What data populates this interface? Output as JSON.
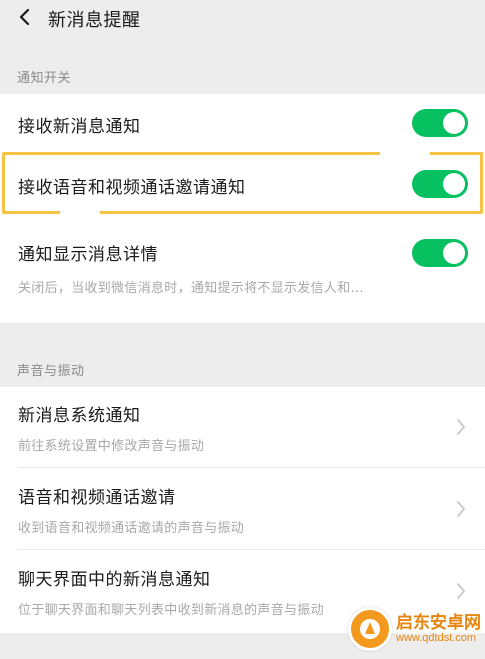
{
  "header": {
    "title": "新消息提醒",
    "back_icon": "back-arrow-icon"
  },
  "sections": {
    "notification_switch": {
      "label": "通知开关"
    },
    "sound_vibration": {
      "label": "声音与振动"
    }
  },
  "rows": {
    "receive_new": {
      "title": "接收新消息通知",
      "enabled": true
    },
    "receive_call": {
      "title": "接收语音和视频通话邀请通知",
      "enabled": true
    },
    "show_detail": {
      "title": "通知显示消息详情",
      "subtitle": "关闭后，当收到微信消息时，通知提示将不显示发信人和...",
      "enabled": true
    },
    "system_notify": {
      "title": "新消息系统通知",
      "subtitle": "前往系统设置中修改声音与振动"
    },
    "call_invite": {
      "title": "语音和视频通话邀请",
      "subtitle": "收到语音和视频通话邀请的声音与振动"
    },
    "chat_notify": {
      "title": "聊天界面中的新消息通知",
      "subtitle": "位于聊天界面和聊天列表中收到新消息的声音与振动"
    }
  },
  "watermark": {
    "name": "启东安卓网",
    "url": "www.qdtdst.com"
  },
  "colors": {
    "toggle_on": "#07c160",
    "highlight": "#f6c445",
    "background": "#ededed"
  }
}
